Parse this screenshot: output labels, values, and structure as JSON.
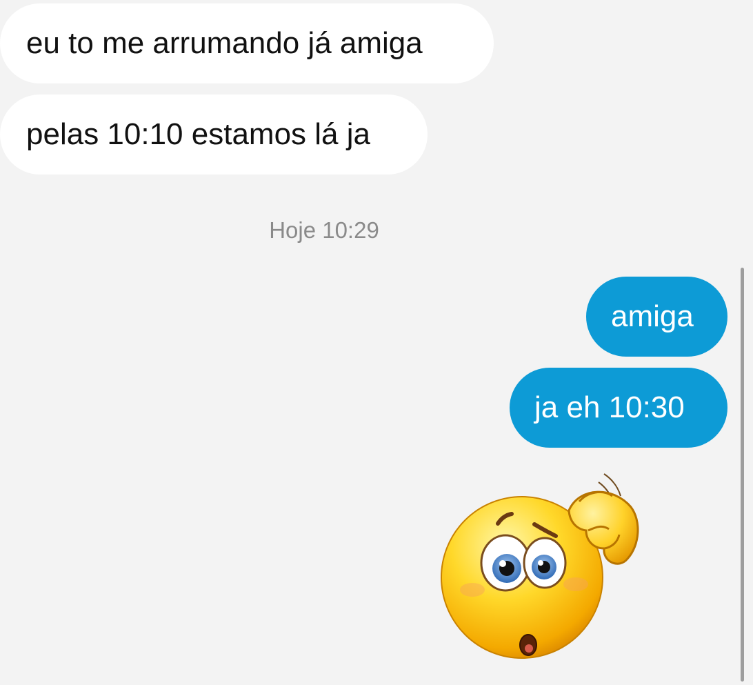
{
  "conversation": {
    "incoming": [
      {
        "text": "eu to me arrumando já amiga"
      },
      {
        "text": "pelas 10:10 estamos lá ja"
      }
    ],
    "timestamp": "Hoje 10:29",
    "outgoing": [
      {
        "text": "amiga"
      },
      {
        "text": "ja eh 10:30"
      }
    ],
    "sticker": {
      "icon": "confused-scratching-head-emoji-icon"
    }
  },
  "colors": {
    "background": "#f3f3f3",
    "incoming_bubble": "#ffffff",
    "outgoing_bubble": "#0d9bd6",
    "timestamp_text": "#8a8a8a"
  }
}
